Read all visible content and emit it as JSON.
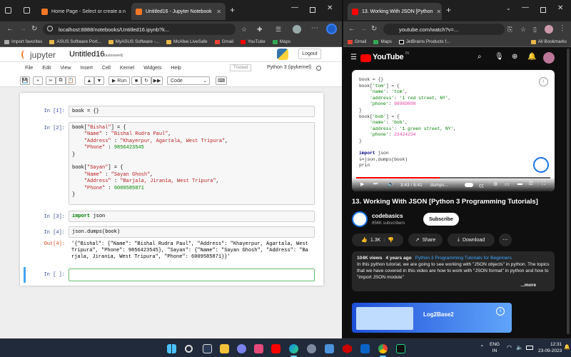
{
  "left_browser": {
    "tabs": [
      {
        "title": "Home Page - Select or create a n"
      },
      {
        "title": "Untitled16 - Jupyter Notebook"
      }
    ],
    "url": "localhost:8888/notebooks/Untitled16.ipynb?k...",
    "bookmarks": [
      "Import favorites",
      "ASUS Software Port...",
      "MyASUS Software -...",
      "McAfee LiveSafe",
      "Gmail",
      "YouTube",
      "Maps"
    ]
  },
  "jupyter": {
    "logo": "jupyter",
    "title": "Untitled16",
    "autosave": "(autosaved)",
    "logout": "Logout",
    "menu": [
      "File",
      "Edit",
      "View",
      "Insert",
      "Cell",
      "Kernel",
      "Widgets",
      "Help"
    ],
    "trusted": "Trusted",
    "kernel": "Python 3 (ipykernel)",
    "run_label": "Run",
    "cell_type": "Code",
    "cells": [
      {
        "prompt": "In [1]:",
        "code": "book = {}"
      },
      {
        "prompt": "In [2]:"
      },
      {
        "prompt": "In [3]:"
      },
      {
        "prompt": "In [4]:",
        "code": "json.dumps(book)"
      },
      {
        "prompt": "In [ ]:"
      }
    ],
    "output": {
      "prompt": "Out[4]:",
      "lines": [
        "'{\"Bishal\": {\"Name\": \"Bishal Rudra Paul\", \"Address\": \"Khayerpur, Agartala, West Tripura\", \"Phone\": 9856423545}, \"Sayan\": {\"Name\": \"Sayan Ghosh\", \"Address\": \"Ba",
        "rjala, Jirania, West Tripura\", \"Phone\": 6009585871}}'"
      ]
    }
  },
  "right_browser": {
    "tab_title": "13. Working With JSON [Python ",
    "url": "youtube.com/watch?v=...",
    "bookmarks": [
      "Gmail",
      "Maps",
      "JetBrains Products f...",
      "All Bookmarks"
    ]
  },
  "youtube": {
    "logo": "YouTube",
    "country": "IN",
    "time": "3:43 / 8:41",
    "chapter": "dumps...",
    "video_title": "13. Working With JSON [Python 3 Programming Tutorials]",
    "channel": "codebasics",
    "subscribers": "856K subscribers",
    "subscribe": "Subscribe",
    "likes": "1.3K",
    "share": "Share",
    "download": "Download",
    "views": "104K views",
    "age": "4 years ago",
    "playlist": "Python 3 Programming Tutorials for Beginners",
    "description": "In this python tutorial, we are going to see working with \"JSON objects\" in python. The topics that we have covered in this video are how to work with \"JSON format\" in python and how to \"import JSON module\"",
    "more": "...more",
    "ad_title": "Log2Base2"
  },
  "taskbar": {
    "lang": "ENG",
    "region": "IN",
    "time": "12:31",
    "date": "23-09-2023"
  }
}
